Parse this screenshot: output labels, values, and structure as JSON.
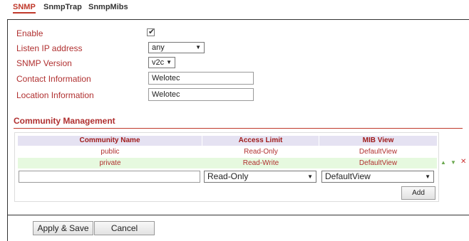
{
  "tabs": [
    {
      "label": "SNMP"
    },
    {
      "label": "SnmpTrap"
    },
    {
      "label": "SnmpMibs"
    }
  ],
  "form": {
    "enable_label": "Enable",
    "enable_checked": true,
    "listen_ip_label": "Listen IP address",
    "listen_ip_value": "any",
    "snmp_version_label": "SNMP Version",
    "snmp_version_value": "v2c",
    "contact_label": "Contact Information",
    "contact_value": "Welotec",
    "location_label": "Location Information",
    "location_value": "Welotec"
  },
  "community": {
    "title": "Community Management",
    "columns": [
      "Community Name",
      "Access Limit",
      "MIB View"
    ],
    "rows": [
      {
        "name": "public",
        "access": "Read-Only",
        "mib": "DefaultView"
      },
      {
        "name": "private",
        "access": "Read-Write",
        "mib": "DefaultView"
      }
    ],
    "new_row": {
      "name_value": "",
      "access_value": "Read-Only",
      "mib_value": "DefaultView"
    },
    "add_label": "Add"
  },
  "footer": {
    "apply_label": "Apply & Save",
    "cancel_label": "Cancel"
  },
  "colors": {
    "accent": "#c0392b",
    "label_red": "#b03030",
    "header_bg": "#e5e2f2",
    "alt_row_bg": "#e6f9df",
    "move_icon_green": "#6aa84f",
    "delete_icon_red": "#cc3333"
  },
  "icons": {
    "move_up": "arrow-up-icon",
    "move_down": "arrow-down-icon",
    "delete": "close-icon"
  }
}
